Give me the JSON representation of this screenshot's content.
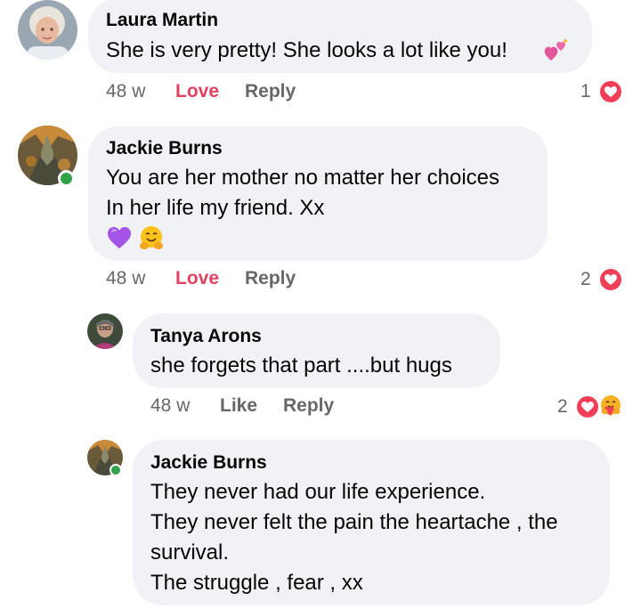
{
  "comments": [
    {
      "author": "Laura Martin",
      "lines": [
        "She is very pretty! She looks a lot like you!"
      ],
      "time": "48 w",
      "reaction_label": "Love",
      "reply_label": "Reply",
      "reaction_count": "1"
    },
    {
      "author": "Jackie Burns",
      "lines": [
        "You are her mother no matter her choices",
        "In her life my friend. Xx"
      ],
      "time": "48 w",
      "reaction_label": "Love",
      "reply_label": "Reply",
      "reaction_count": "2"
    },
    {
      "author": "Tanya Arons",
      "lines": [
        "she forgets that part ....but hugs"
      ],
      "time": "48 w",
      "reaction_label": "Like",
      "reply_label": "Reply",
      "reaction_count": "2"
    },
    {
      "author": "Jackie Burns",
      "lines": [
        "They never had our life experience.",
        "They never felt the pain the heartache , the",
        "survival.",
        "The struggle , fear , xx"
      ]
    }
  ],
  "icons": {
    "love_reaction": "heart-reaction-icon",
    "care_reaction": "care-reaction-icon",
    "sparkling_hearts": "sparkling-hearts-emoji",
    "purple_heart": "purple-heart-emoji",
    "hugging_face": "hugging-face-emoji"
  },
  "colors": {
    "bubble": "#f0f2f5",
    "love": "#e4405f",
    "secondary_text": "#65676b",
    "online": "#31a24c"
  }
}
